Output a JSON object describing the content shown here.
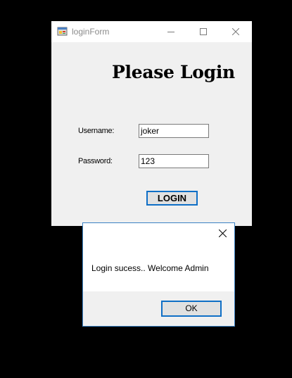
{
  "login_window": {
    "title": "loginForm",
    "icon": "form-app-icon",
    "controls": {
      "minimize_icon": "minimize-icon",
      "maximize_icon": "maximize-icon",
      "close_icon": "close-icon"
    },
    "heading": "Please Login",
    "username": {
      "label": "Username:",
      "value": "joker"
    },
    "password": {
      "label": "Password:",
      "value": "123"
    },
    "login_button": "LOGIN"
  },
  "message_box": {
    "close_icon": "close-icon",
    "message": "Login sucess.. Welcome Admin",
    "ok_button": "OK"
  },
  "colors": {
    "desktop": "#000000",
    "window_background": "#f0f0f0",
    "titlebar": "#ffffff",
    "title_text": "#8a8a8a",
    "focus_border": "#0f6fc6",
    "dialog_border": "#3b82c4",
    "button_face": "#e1e1e1"
  }
}
